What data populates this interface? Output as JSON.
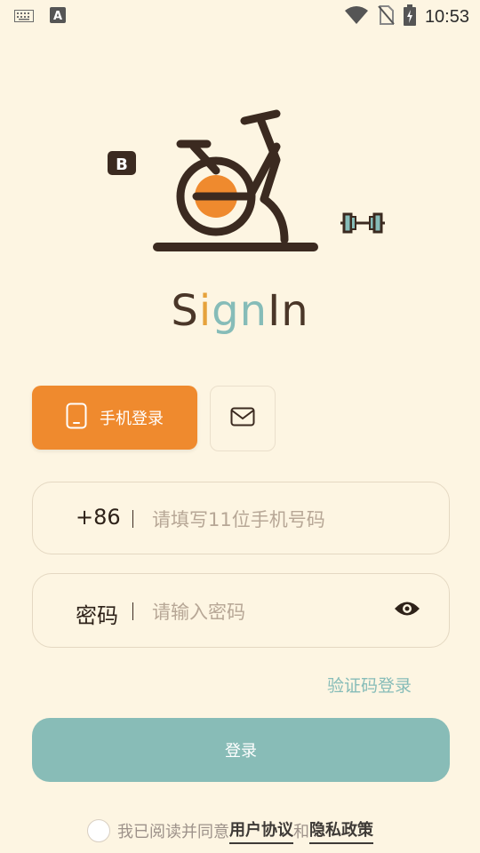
{
  "status": {
    "time": "10:53",
    "icons": [
      "keyboard-icon",
      "a-letter-icon",
      "wifi-icon",
      "no-sim-icon",
      "battery-charging-icon"
    ]
  },
  "hero": {
    "badge": "B"
  },
  "title_parts": [
    "S",
    "i",
    "gn",
    "In"
  ],
  "tabs": {
    "phone_label": "手机登录",
    "email_icon": "mail-icon"
  },
  "phone_field": {
    "prefix": "+86",
    "placeholder": "请填写11位手机号码"
  },
  "password_field": {
    "label": "密码",
    "placeholder": "请输入密码",
    "toggle_icon": "eye-icon"
  },
  "sms_login": "验证码登录",
  "login_button": "登录",
  "agreement": {
    "text1": "我已阅读并同意",
    "link1": "用户协议",
    "and": "和",
    "link2": "隐私政策"
  },
  "colors": {
    "background": "#FDF5E2",
    "accent_orange": "#EF8A2E",
    "accent_teal": "#88BCB7",
    "dark_brown": "#3B2A20"
  }
}
